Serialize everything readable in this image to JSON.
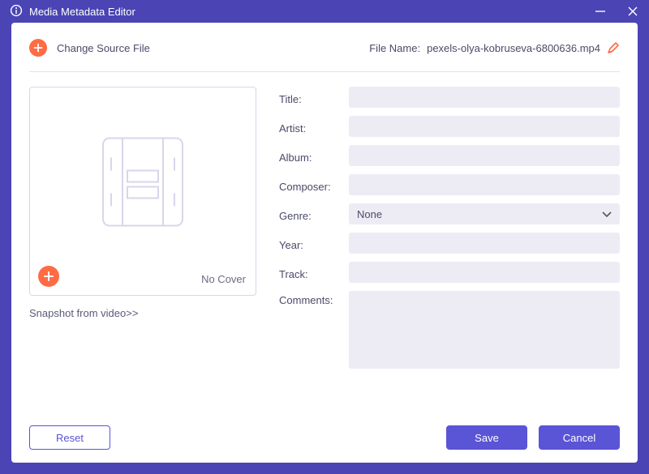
{
  "window": {
    "title": "Media Metadata Editor"
  },
  "topbar": {
    "change_source_label": "Change Source File",
    "filename_label": "File Name:",
    "filename_value": "pexels-olya-kobruseva-6800636.mp4"
  },
  "cover": {
    "no_cover_label": "No Cover",
    "snapshot_link": "Snapshot from video>>"
  },
  "form": {
    "title_label": "Title:",
    "artist_label": "Artist:",
    "album_label": "Album:",
    "composer_label": "Composer:",
    "genre_label": "Genre:",
    "genre_value": "None",
    "year_label": "Year:",
    "track_label": "Track:",
    "comments_label": "Comments:",
    "title_value": "",
    "artist_value": "",
    "album_value": "",
    "composer_value": "",
    "year_value": "",
    "track_value": "",
    "comments_value": ""
  },
  "footer": {
    "reset_label": "Reset",
    "save_label": "Save",
    "cancel_label": "Cancel"
  }
}
